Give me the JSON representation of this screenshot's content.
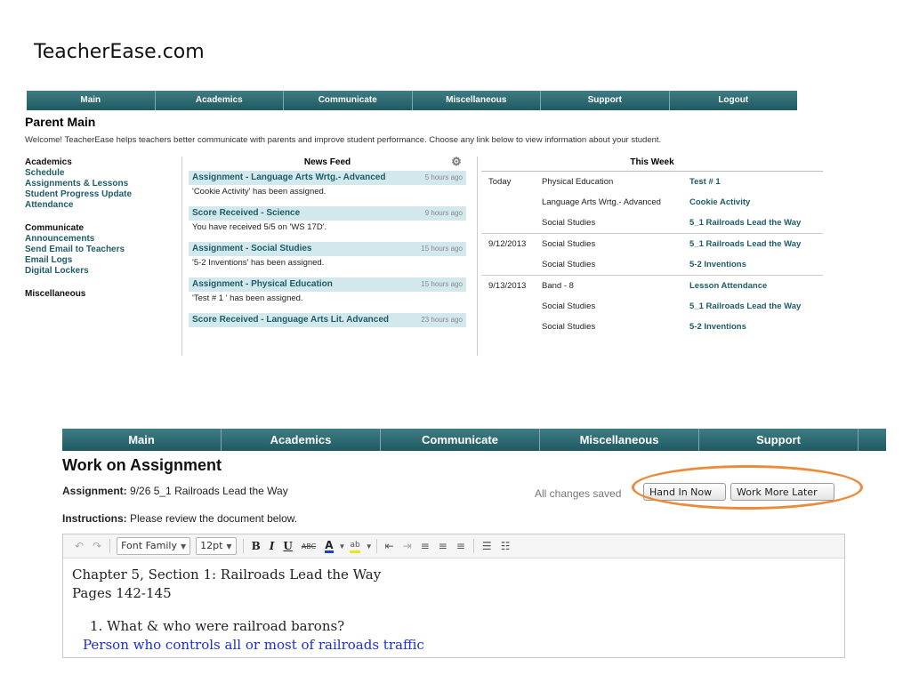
{
  "slide_title": "TeacherEase.com",
  "top": {
    "nav": [
      "Main",
      "Academics",
      "Communicate",
      "Miscellaneous",
      "Support",
      "Logout"
    ],
    "page_title": "Parent Main",
    "welcome": "Welcome! TeacherEase helps teachers better communicate with parents and improve student performance. Choose any link below to view information about your student.",
    "left": {
      "academics_head": "Academics",
      "academics_links": [
        "Schedule",
        "Assignments & Lessons",
        "Student Progress Update",
        "Attendance"
      ],
      "communicate_head": "Communicate",
      "communicate_links": [
        "Announcements",
        "Send Email to Teachers",
        "Email Logs",
        "Digital Lockers"
      ],
      "misc_head": "Miscellaneous"
    },
    "news_feed": {
      "title": "News Feed",
      "items": [
        {
          "title": "Assignment - Language Arts Wrtg.- Advanced",
          "age": "5 hours ago",
          "desc": "'Cookie Activity' has been assigned."
        },
        {
          "title": "Score Received - Science",
          "age": "9 hours ago",
          "desc": "You have received 5/5 on 'WS 17D'."
        },
        {
          "title": "Assignment - Social Studies",
          "age": "15 hours ago",
          "desc": "'5-2 Inventions' has been assigned."
        },
        {
          "title": "Assignment - Physical Education",
          "age": "15 hours ago",
          "desc": "'Test # 1 ' has been assigned."
        },
        {
          "title": "Score Received - Language Arts Lit. Advanced",
          "age": "23 hours ago",
          "desc": ""
        }
      ]
    },
    "this_week": {
      "title": "This Week",
      "rows": [
        {
          "date": "Today",
          "course": "Physical Education",
          "assignment": "Test # 1"
        },
        {
          "date": "",
          "course": "Language Arts Wrtg.- Advanced",
          "assignment": "Cookie Activity"
        },
        {
          "date": "",
          "course": "Social Studies",
          "assignment": "5_1 Railroads Lead the Way"
        },
        {
          "date": "9/12/2013",
          "course": "Social Studies",
          "assignment": "5_1 Railroads Lead the Way"
        },
        {
          "date": "",
          "course": "Social Studies",
          "assignment": "5-2 Inventions"
        },
        {
          "date": "9/13/2013",
          "course": "Band - 8",
          "assignment": "Lesson Attendance"
        },
        {
          "date": "",
          "course": "Social Studies",
          "assignment": "5_1 Railroads Lead the Way"
        },
        {
          "date": "",
          "course": "Social Studies",
          "assignment": "5-2 Inventions"
        }
      ]
    }
  },
  "bottom": {
    "nav": [
      "Main",
      "Academics",
      "Communicate",
      "Miscellaneous",
      "Support"
    ],
    "page_title": "Work on Assignment",
    "assignment_label": "Assignment:",
    "assignment_value": " 9/26 5_1 Railroads Lead the Way",
    "instructions_label": "Instructions:",
    "instructions_value": " Please review the document below.",
    "saved_status": "All changes saved",
    "hand_in_label": "Hand In Now",
    "work_later_label": "Work More Later",
    "toolbar": {
      "font_family": "Font Family",
      "font_size": "12pt"
    },
    "document": {
      "line1": "Chapter 5, Section 1:  Railroads Lead the Way",
      "line2": "Pages 142-145",
      "question": "1.  What & who were railroad barons?",
      "answer": "Person who controls all or most of railroads traffic"
    }
  }
}
